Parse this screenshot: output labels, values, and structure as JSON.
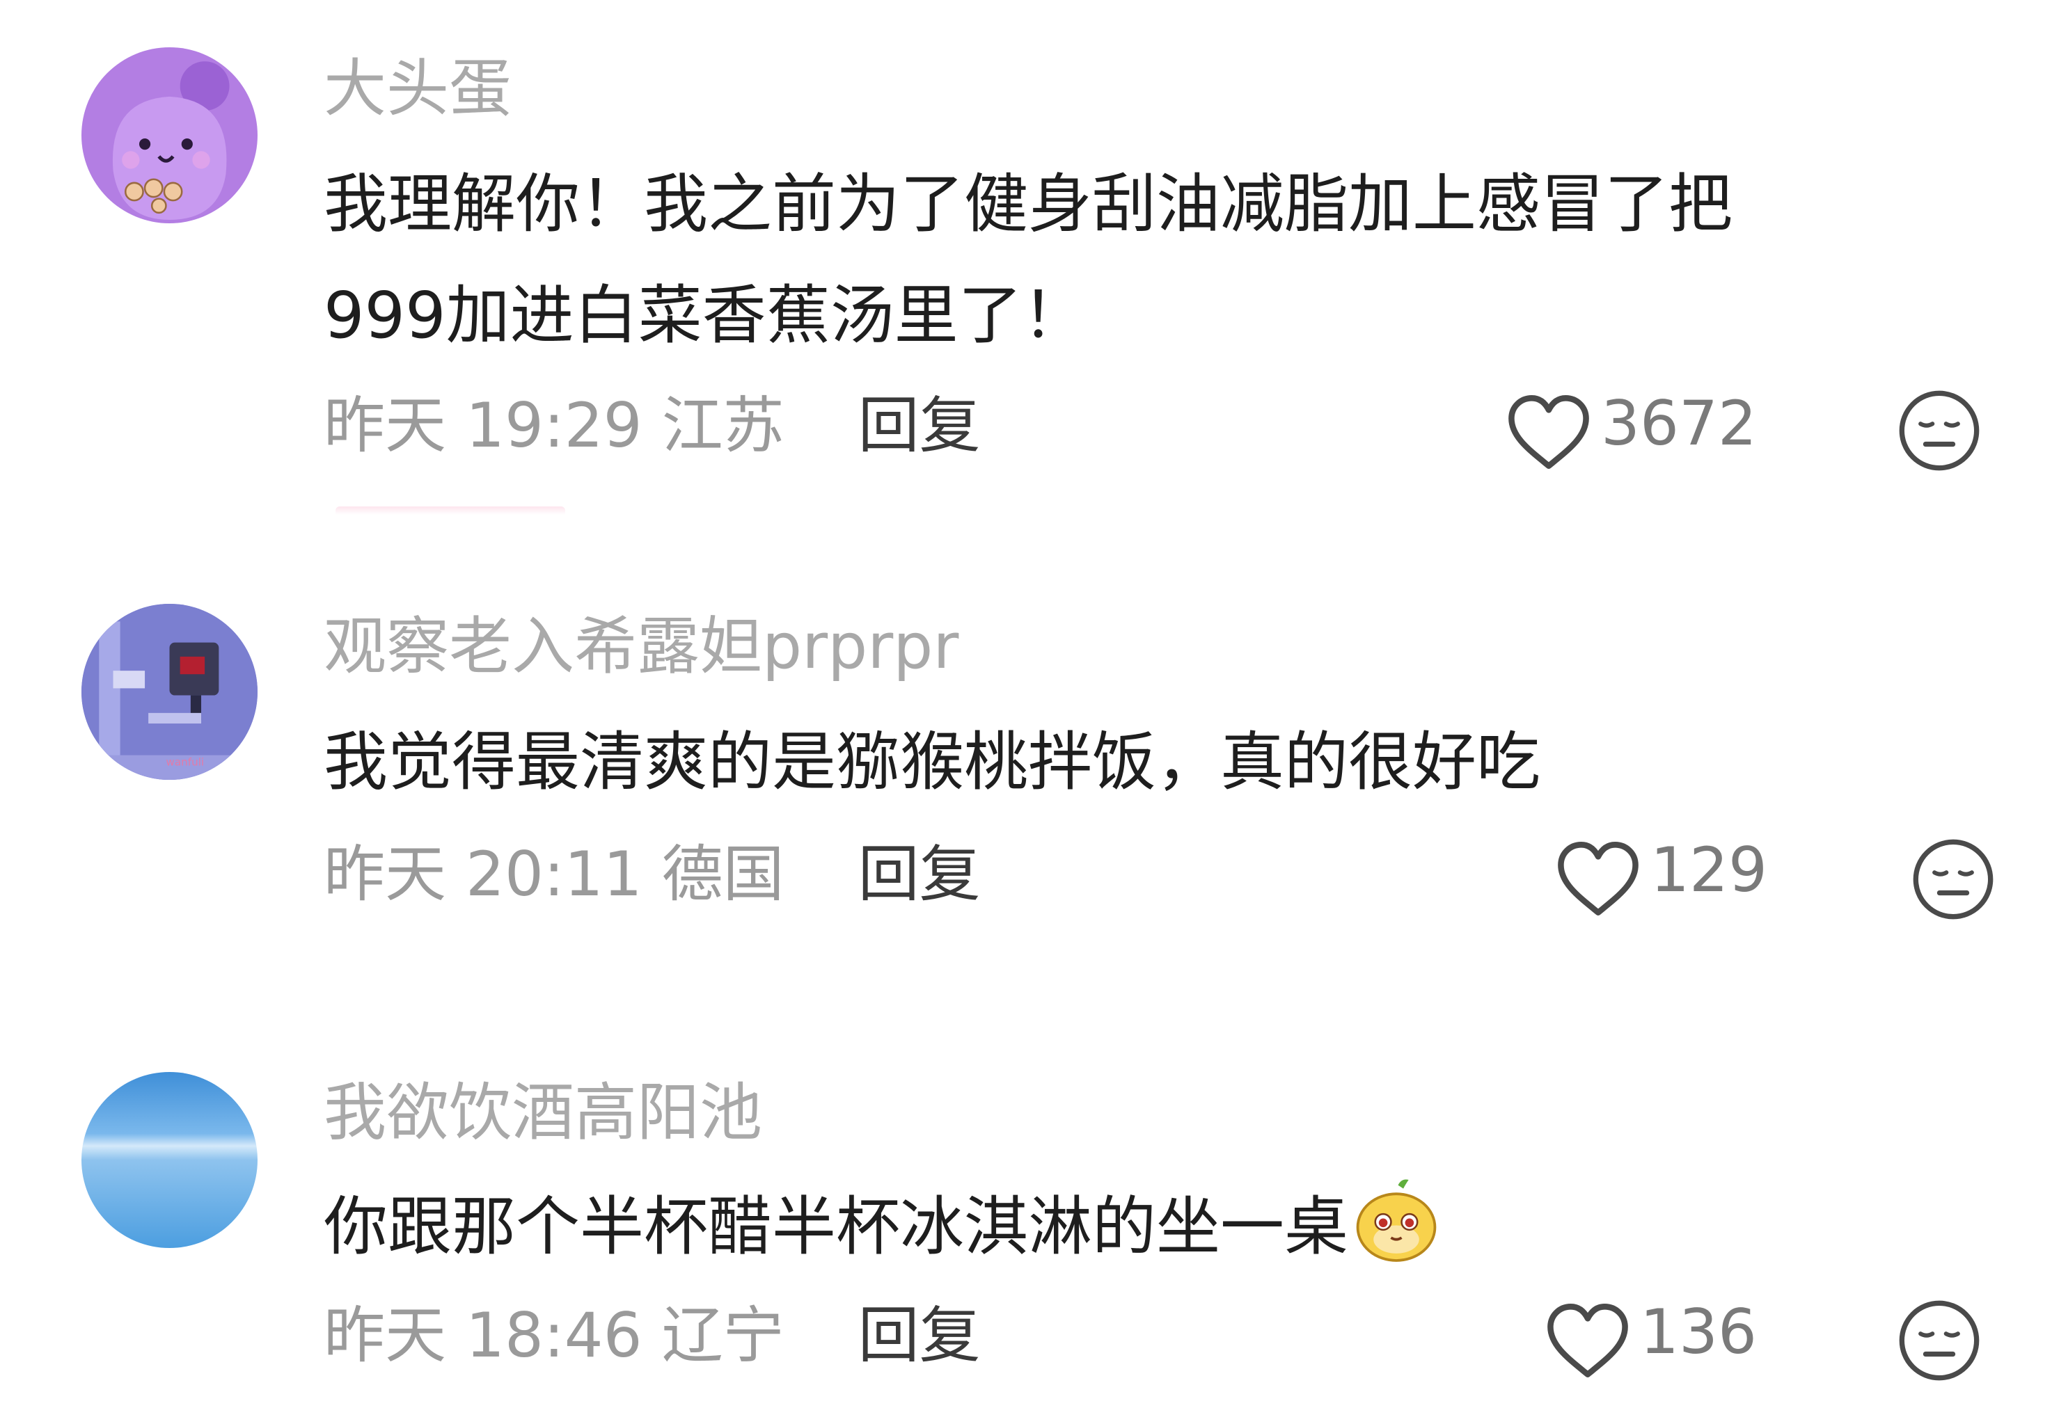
{
  "colors": {
    "username": "#a9a9a9",
    "content": "#1e1e1e",
    "meta": "#9a9a9a",
    "reply": "#3a3a3a",
    "like_count": "#7a7a7a"
  },
  "comments": [
    {
      "avatar_icon": "purple-cartoon-avatar",
      "username": "大头蛋",
      "content_lines": [
        "我理解你！我之前为了健身刮油减脂加上感冒了把",
        "999加进白菜香蕉汤里了！"
      ],
      "time": "昨天 19:29",
      "location": "江苏",
      "reply_label": "回复",
      "like_count": "3672",
      "like_icon": "heart-outline-icon",
      "dislike_icon": "meh-face-icon"
    },
    {
      "avatar_icon": "robot-photo-avatar",
      "username": "观察老入希露妲prprpr",
      "content_lines": [
        "我觉得最清爽的是猕猴桃拌饭，真的很好吃"
      ],
      "time": "昨天 20:11",
      "location": "德国",
      "reply_label": "回复",
      "like_count": "129",
      "like_icon": "heart-outline-icon",
      "dislike_icon": "meh-face-icon"
    },
    {
      "avatar_icon": "sky-photo-avatar",
      "username": "我欲饮酒高阳池",
      "content_lines": [
        "你跟那个半杯醋半杯冰淇淋的坐一桌"
      ],
      "sticker_icon": "smirk-emoji-sticker",
      "time": "昨天 18:46",
      "location": "辽宁",
      "reply_label": "回复",
      "like_count": "136",
      "like_icon": "heart-outline-icon",
      "dislike_icon": "meh-face-icon"
    }
  ]
}
